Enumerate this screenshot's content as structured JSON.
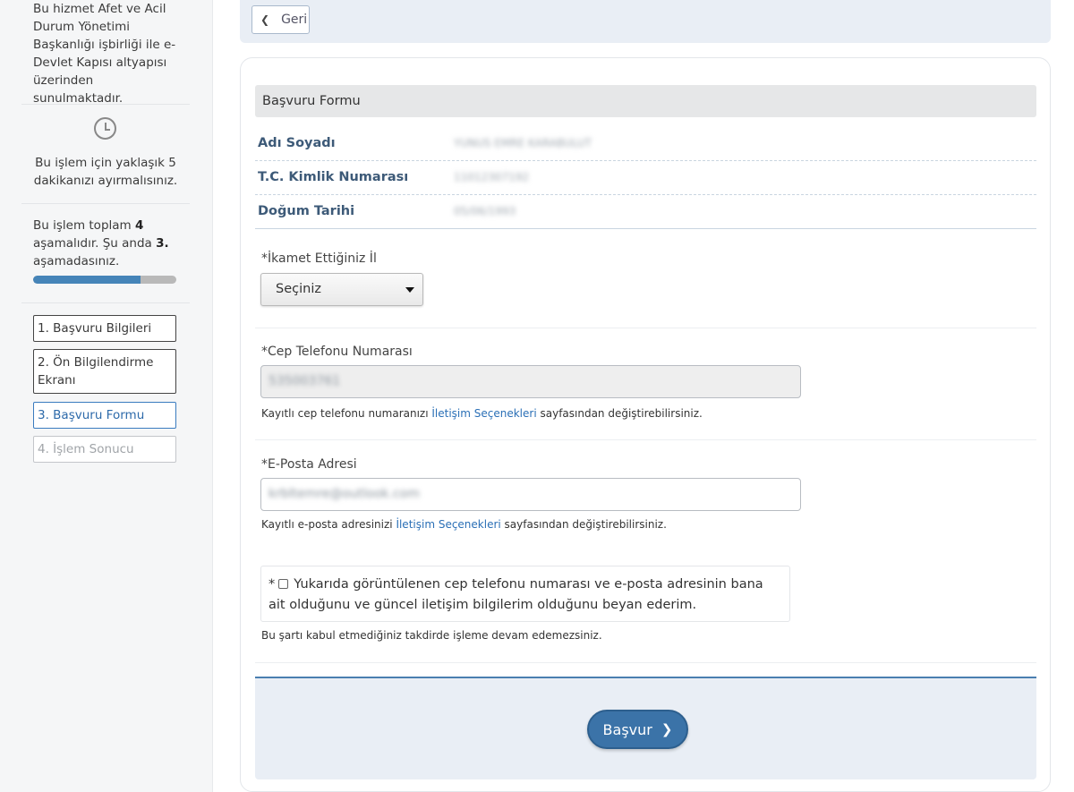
{
  "sidebar": {
    "info_text": "Bu hizmet Afet ve Acil Durum Yönetimi Başkanlığı işbirliği ile e-Devlet Kapısı altyapısı üzerinden sunulmaktadır.",
    "time_text": "Bu işlem için yaklaşık 5 dakikanızı ayırmalısınız.",
    "steps_prefix": "Bu işlem toplam ",
    "steps_total": "4",
    "steps_mid": " aşamalıdır. Şu anda ",
    "steps_current": "3.",
    "steps_suffix": " aşamadasınız.",
    "progress_fraction": 0.75,
    "steps": [
      {
        "label": "1. Başvuru Bilgileri",
        "state": "done"
      },
      {
        "label": "2. Ön Bilgilendirme Ekranı",
        "state": "done"
      },
      {
        "label": "3. Başvuru Formu",
        "state": "active"
      },
      {
        "label": "4. İşlem Sonucu",
        "state": "future"
      }
    ]
  },
  "topbar": {
    "back_label": "Geri"
  },
  "form": {
    "title": "Başvuru Formu",
    "info": [
      {
        "label": "Adı Soyadı",
        "value": "YUNUS EMRE KARABULUT"
      },
      {
        "label": "T.C. Kimlik Numarası",
        "value": "11012307192"
      },
      {
        "label": "Doğum Tarihi",
        "value": "05/06/1993"
      }
    ],
    "city": {
      "label": "*İkamet Ettiğiniz İl",
      "selected": "Seçiniz"
    },
    "phone": {
      "label": "*Cep Telefonu Numarası",
      "value": "535003761",
      "help_prefix": "Kayıtlı cep telefonu numaranızı ",
      "help_link": "İletişim Seçenekleri",
      "help_suffix": " sayfasından değiştirebilirsiniz."
    },
    "email": {
      "label": "*E-Posta Adresi",
      "value": "krbltemre@outlook.com",
      "help_prefix": "Kayıtlı e-posta adresinizi ",
      "help_link": "İletişim Seçenekleri",
      "help_suffix": " sayfasından değiştirebilirsiniz."
    },
    "consent": {
      "required_mark": "*",
      "text": "Yukarıda görüntülenen cep telefonu numarası ve e-posta adresinin bana ait olduğunu ve güncel iletişim bilgilerim olduğunu beyan ederim.",
      "help": "Bu şartı kabul etmediğiniz takdirde işleme devam edemezsiniz."
    },
    "submit_label": "Başvur"
  },
  "colors": {
    "accent": "#3b73a8",
    "progress": "#4584b8",
    "label_blue": "#3d5a78",
    "link": "#2a6fb6"
  }
}
